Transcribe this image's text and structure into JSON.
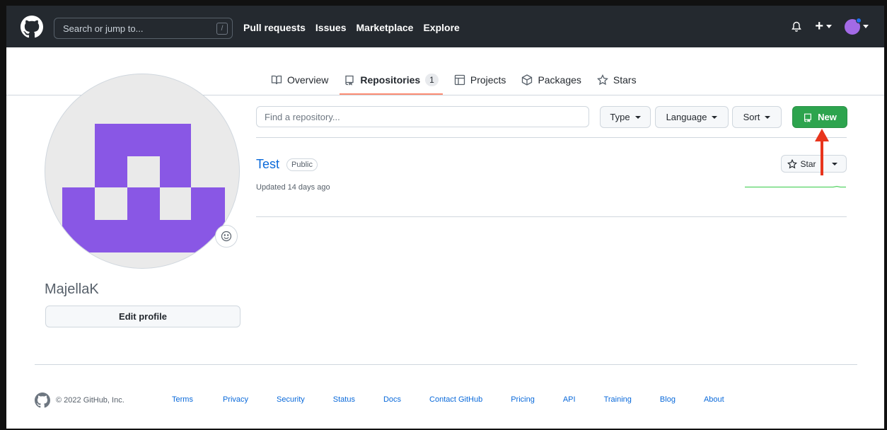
{
  "header": {
    "search_placeholder": "Search or jump to...",
    "search_shortcut": "/",
    "nav": [
      "Pull requests",
      "Issues",
      "Marketplace",
      "Explore"
    ],
    "plus": "+"
  },
  "tabs": [
    {
      "label": "Overview",
      "icon": "book-icon"
    },
    {
      "label": "Repositories",
      "icon": "repo-icon",
      "count": "1",
      "selected": true
    },
    {
      "label": "Projects",
      "icon": "table-icon"
    },
    {
      "label": "Packages",
      "icon": "package-icon"
    },
    {
      "label": "Stars",
      "icon": "star-icon"
    }
  ],
  "profile": {
    "username": "MajellaK",
    "edit_label": "Edit profile",
    "avatar_color": "#8957e5"
  },
  "toolbar": {
    "find_placeholder": "Find a repository...",
    "type_label": "Type",
    "language_label": "Language",
    "sort_label": "Sort",
    "new_label": "New",
    "new_color": "#2da44e"
  },
  "repo": {
    "name": "Test",
    "visibility": "Public",
    "updated": "Updated 14 days ago",
    "star_label": "Star"
  },
  "footer": {
    "copyright": "© 2022 GitHub, Inc.",
    "links": [
      "Terms",
      "Privacy",
      "Security",
      "Status",
      "Docs",
      "Contact GitHub",
      "Pricing",
      "API",
      "Training",
      "Blog",
      "About"
    ]
  },
  "colors": {
    "header_bg": "#24292f",
    "link": "#0969da",
    "annotation_arrow": "#e8341c"
  }
}
